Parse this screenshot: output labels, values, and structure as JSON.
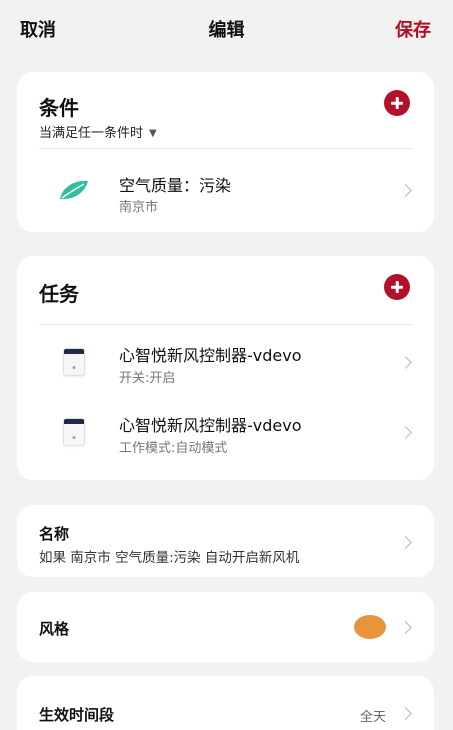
{
  "topbar": {
    "cancel": "取消",
    "title": "编辑",
    "save": "保存"
  },
  "conditions": {
    "title": "条件",
    "mode": "当满足任一条件时",
    "items": [
      {
        "main": "空气质量：污染",
        "sub": "南京市",
        "icon": "leaf-icon"
      }
    ]
  },
  "tasks": {
    "title": "任务",
    "items": [
      {
        "main": "心智悦新风控制器-vdevo",
        "sub": "开关:开启",
        "icon": "device-icon"
      },
      {
        "main": "心智悦新风控制器-vdevo",
        "sub": "工作模式:自动模式",
        "icon": "device-icon"
      }
    ]
  },
  "name": {
    "label": "名称",
    "value": "如果 南京市 空气质量:污染 自动开启新风机"
  },
  "style": {
    "label": "风格",
    "color": "#e8943b"
  },
  "period": {
    "label": "生效时间段",
    "value": "全天"
  },
  "colors": {
    "accent": "#b3112a",
    "leaf": "#2fbf9a"
  }
}
